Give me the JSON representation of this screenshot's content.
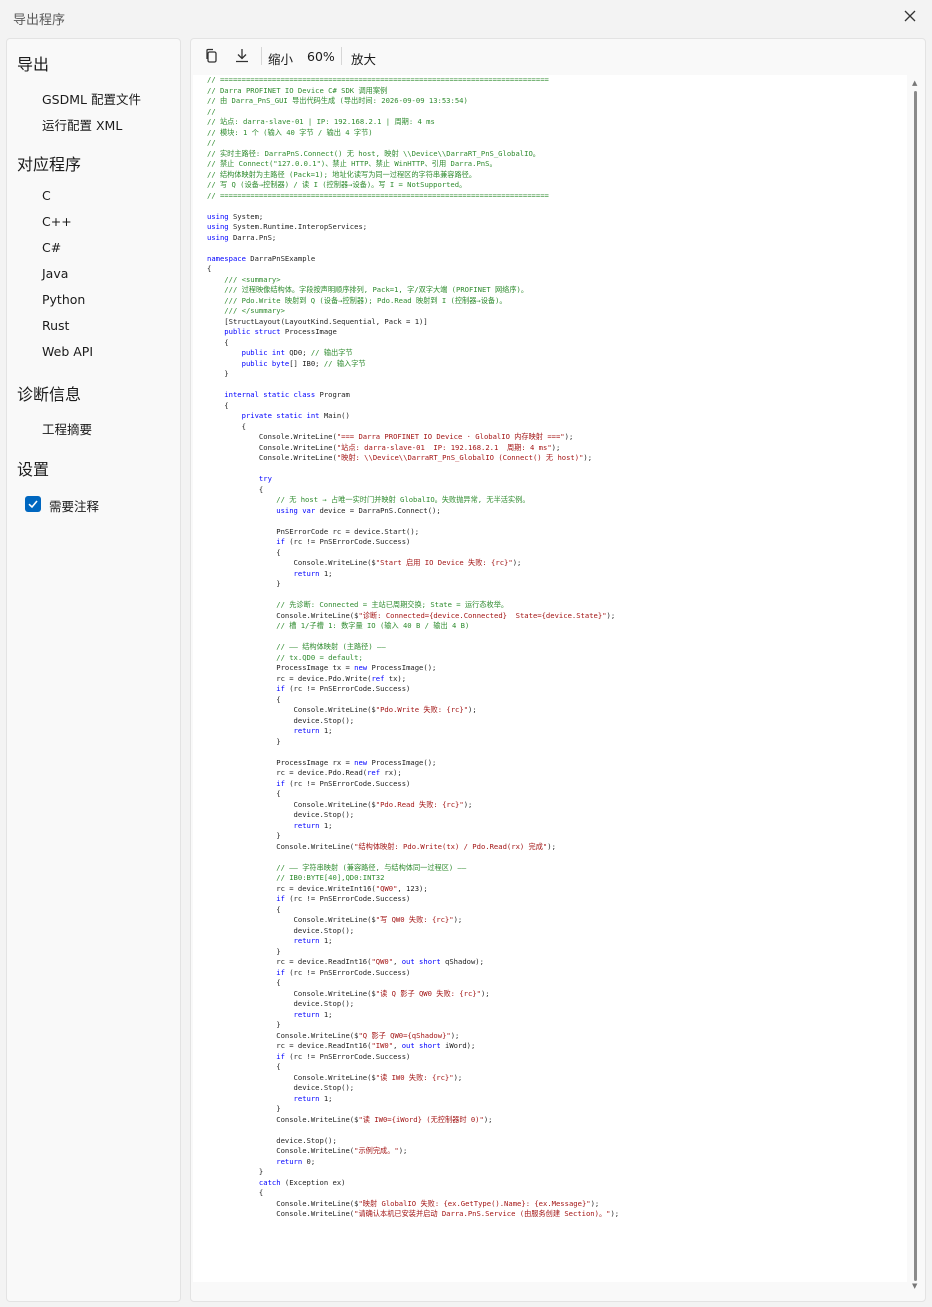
{
  "window": {
    "title": "导出程序"
  },
  "sidebar": {
    "sections": [
      {
        "title": "导出",
        "items": [
          "GSDML 配置文件",
          "运行配置 XML"
        ]
      },
      {
        "title": "对应程序",
        "items": [
          "C",
          "C++",
          "C#",
          "Java",
          "Python",
          "Rust",
          "Web API"
        ]
      },
      {
        "title": "诊断信息",
        "items": [
          "工程摘要"
        ]
      },
      {
        "title": "设置",
        "items": []
      }
    ],
    "checkbox": {
      "label": "需要注释",
      "checked": true
    }
  },
  "toolbar": {
    "zoom_out": "缩小",
    "zoom": "60%",
    "zoom_in": "放大"
  },
  "code": [
    [
      [
        "c",
        "// ============================================================================"
      ]
    ],
    [
      [
        "c",
        "// Darra PROFINET IO Device C# SDK 调用案例"
      ]
    ],
    [
      [
        "c",
        "// 由 Darra_PnS_GUI 导出代码生成 (导出时间: 2026-09-09 13:53:54)"
      ]
    ],
    [
      [
        "c",
        "//"
      ]
    ],
    [
      [
        "c",
        "// 站点: darra-slave-01 | IP: 192.168.2.1 | 周期: 4 ms"
      ]
    ],
    [
      [
        "c",
        "// 模块: 1 个 (输入 40 字节 / 输出 4 字节)"
      ]
    ],
    [
      [
        "c",
        "//"
      ]
    ],
    [
      [
        "c",
        "// 实时主路径: DarraPnS.Connect() 无 host, 映射 \\\\Device\\\\DarraRT_PnS_GlobalIO。"
      ]
    ],
    [
      [
        "c",
        "// 禁止 Connect(\"127.0.0.1\")、禁止 HTTP、禁止 WinHTTP、引用 Darra.PnS。"
      ]
    ],
    [
      [
        "c",
        "// 结构体映射为主路径 (Pack=1); 地址化读写为同一过程区的字符串兼容路径。"
      ]
    ],
    [
      [
        "c",
        "// 写 Q (设备→控制器) / 读 I (控制器→设备)。写 I = NotSupported。"
      ]
    ],
    [
      [
        "c",
        "// ============================================================================"
      ]
    ],
    [],
    [
      [
        "k",
        "using"
      ],
      [
        "p",
        " System;"
      ]
    ],
    [
      [
        "k",
        "using"
      ],
      [
        "p",
        " System.Runtime.InteropServices;"
      ]
    ],
    [
      [
        "k",
        "using"
      ],
      [
        "p",
        " Darra.PnS;"
      ]
    ],
    [],
    [
      [
        "k",
        "namespace"
      ],
      [
        "p",
        " DarraPnSExample"
      ]
    ],
    [
      [
        "p",
        "{"
      ]
    ],
    [
      [
        "c",
        "    /// <summary>"
      ]
    ],
    [
      [
        "c",
        "    /// 过程映像结构体。字段按声明顺序排列, Pack=1, 字/双字大端 (PROFINET 网络序)。"
      ]
    ],
    [
      [
        "c",
        "    /// Pdo.Write 映射到 Q (设备→控制器); Pdo.Read 映射到 I (控制器→设备)。"
      ]
    ],
    [
      [
        "c",
        "    /// </summary>"
      ]
    ],
    [
      [
        "p",
        "    [StructLayout(LayoutKind.Sequential, Pack = 1)]"
      ]
    ],
    [
      [
        "k",
        "    public struct"
      ],
      [
        "p",
        " ProcessImage"
      ]
    ],
    [
      [
        "p",
        "    {"
      ]
    ],
    [
      [
        "k",
        "        public int"
      ],
      [
        "p",
        " QD0; "
      ],
      [
        "c",
        "// 输出字节"
      ]
    ],
    [
      [
        "k",
        "        public byte"
      ],
      [
        "p",
        "[] IB0; "
      ],
      [
        "c",
        "// 输入字节"
      ]
    ],
    [
      [
        "p",
        "    }"
      ]
    ],
    [],
    [
      [
        "k",
        "    internal static class"
      ],
      [
        "p",
        " Program"
      ]
    ],
    [
      [
        "p",
        "    {"
      ]
    ],
    [
      [
        "k",
        "        private static int"
      ],
      [
        "p",
        " Main()"
      ]
    ],
    [
      [
        "p",
        "        {"
      ]
    ],
    [
      [
        "p",
        "            Console.WriteLine("
      ],
      [
        "s",
        "\"=== Darra PROFINET IO Device · GlobalIO 内存映射 ===\""
      ],
      [
        "p",
        ");"
      ]
    ],
    [
      [
        "p",
        "            Console.WriteLine("
      ],
      [
        "s",
        "\"站点: darra-slave-01  IP: 192.168.2.1  周期: 4 ms\""
      ],
      [
        "p",
        ");"
      ]
    ],
    [
      [
        "p",
        "            Console.WriteLine("
      ],
      [
        "s",
        "\"映射: \\\\Device\\\\DarraRT_PnS_GlobalIO (Connect() 无 host)\""
      ],
      [
        "p",
        ");"
      ]
    ],
    [],
    [
      [
        "k",
        "            try"
      ]
    ],
    [
      [
        "p",
        "            {"
      ]
    ],
    [
      [
        "c",
        "                // 无 host → 占唯一实时门并映射 GlobalIO。失败抛异常, 无半活实例。"
      ]
    ],
    [
      [
        "k",
        "                using var"
      ],
      [
        "p",
        " device = DarraPnS.Connect();"
      ]
    ],
    [],
    [
      [
        "p",
        "                PnSErrorCode rc = device.Start();"
      ]
    ],
    [
      [
        "k",
        "                if"
      ],
      [
        "p",
        " (rc != PnSErrorCode.Success)"
      ]
    ],
    [
      [
        "p",
        "                {"
      ]
    ],
    [
      [
        "p",
        "                    Console.WriteLine($"
      ],
      [
        "s",
        "\"Start 启用 IO Device 失败: {rc}\""
      ],
      [
        "p",
        ");"
      ]
    ],
    [
      [
        "k",
        "                    return"
      ],
      [
        "p",
        " 1;"
      ]
    ],
    [
      [
        "p",
        "                }"
      ]
    ],
    [],
    [
      [
        "c",
        "                // 先诊断: Connected = 主站已周期交换; State = 运行态枚举。"
      ]
    ],
    [
      [
        "p",
        "                Console.WriteLine($"
      ],
      [
        "s",
        "\"诊断: Connected={device.Connected}  State={device.State}\""
      ],
      [
        "p",
        ");"
      ]
    ],
    [
      [
        "c",
        "                // 槽 1/子槽 1: 数字量 IO (输入 40 B / 输出 4 B)"
      ]
    ],
    [],
    [
      [
        "c",
        "                // —— 结构体映射 (主路径) ——"
      ]
    ],
    [
      [
        "c",
        "                // tx.QD0 = default;"
      ]
    ],
    [
      [
        "p",
        "                ProcessImage tx = "
      ],
      [
        "k",
        "new"
      ],
      [
        "p",
        " ProcessImage();"
      ]
    ],
    [
      [
        "p",
        "                rc = device.Pdo.Write("
      ],
      [
        "k",
        "ref"
      ],
      [
        "p",
        " tx);"
      ]
    ],
    [
      [
        "k",
        "                if"
      ],
      [
        "p",
        " (rc != PnSErrorCode.Success)"
      ]
    ],
    [
      [
        "p",
        "                {"
      ]
    ],
    [
      [
        "p",
        "                    Console.WriteLine($"
      ],
      [
        "s",
        "\"Pdo.Write 失败: {rc}\""
      ],
      [
        "p",
        ");"
      ]
    ],
    [
      [
        "p",
        "                    device.Stop();"
      ]
    ],
    [
      [
        "k",
        "                    return"
      ],
      [
        "p",
        " 1;"
      ]
    ],
    [
      [
        "p",
        "                }"
      ]
    ],
    [],
    [
      [
        "p",
        "                ProcessImage rx = "
      ],
      [
        "k",
        "new"
      ],
      [
        "p",
        " ProcessImage();"
      ]
    ],
    [
      [
        "p",
        "                rc = device.Pdo.Read("
      ],
      [
        "k",
        "ref"
      ],
      [
        "p",
        " rx);"
      ]
    ],
    [
      [
        "k",
        "                if"
      ],
      [
        "p",
        " (rc != PnSErrorCode.Success)"
      ]
    ],
    [
      [
        "p",
        "                {"
      ]
    ],
    [
      [
        "p",
        "                    Console.WriteLine($"
      ],
      [
        "s",
        "\"Pdo.Read 失败: {rc}\""
      ],
      [
        "p",
        ");"
      ]
    ],
    [
      [
        "p",
        "                    device.Stop();"
      ]
    ],
    [
      [
        "k",
        "                    return"
      ],
      [
        "p",
        " 1;"
      ]
    ],
    [
      [
        "p",
        "                }"
      ]
    ],
    [
      [
        "p",
        "                Console.WriteLine("
      ],
      [
        "s",
        "\"结构体映射: Pdo.Write(tx) / Pdo.Read(rx) 完成\""
      ],
      [
        "p",
        ");"
      ]
    ],
    [],
    [
      [
        "c",
        "                // —— 字符串映射 (兼容路径, 与结构体同一过程区) ——"
      ]
    ],
    [
      [
        "c",
        "                // IB0:BYTE[40],QD0:INT32"
      ]
    ],
    [
      [
        "p",
        "                rc = device.WriteInt16("
      ],
      [
        "s",
        "\"QW0\""
      ],
      [
        "p",
        ", 123);"
      ]
    ],
    [
      [
        "k",
        "                if"
      ],
      [
        "p",
        " (rc != PnSErrorCode.Success)"
      ]
    ],
    [
      [
        "p",
        "                {"
      ]
    ],
    [
      [
        "p",
        "                    Console.WriteLine($"
      ],
      [
        "s",
        "\"写 QW0 失败: {rc}\""
      ],
      [
        "p",
        ");"
      ]
    ],
    [
      [
        "p",
        "                    device.Stop();"
      ]
    ],
    [
      [
        "k",
        "                    return"
      ],
      [
        "p",
        " 1;"
      ]
    ],
    [
      [
        "p",
        "                }"
      ]
    ],
    [
      [
        "p",
        "                rc = device.ReadInt16("
      ],
      [
        "s",
        "\"QW0\""
      ],
      [
        "p",
        ", "
      ],
      [
        "k",
        "out short"
      ],
      [
        "p",
        " qShadow);"
      ]
    ],
    [
      [
        "k",
        "                if"
      ],
      [
        "p",
        " (rc != PnSErrorCode.Success)"
      ]
    ],
    [
      [
        "p",
        "                {"
      ]
    ],
    [
      [
        "p",
        "                    Console.WriteLine($"
      ],
      [
        "s",
        "\"读 Q 影子 QW0 失败: {rc}\""
      ],
      [
        "p",
        ");"
      ]
    ],
    [
      [
        "p",
        "                    device.Stop();"
      ]
    ],
    [
      [
        "k",
        "                    return"
      ],
      [
        "p",
        " 1;"
      ]
    ],
    [
      [
        "p",
        "                }"
      ]
    ],
    [
      [
        "p",
        "                Console.WriteLine($"
      ],
      [
        "s",
        "\"Q 影子 QW0={qShadow}\""
      ],
      [
        "p",
        ");"
      ]
    ],
    [
      [
        "p",
        "                rc = device.ReadInt16("
      ],
      [
        "s",
        "\"IW0\""
      ],
      [
        "p",
        ", "
      ],
      [
        "k",
        "out short"
      ],
      [
        "p",
        " iWord);"
      ]
    ],
    [
      [
        "k",
        "                if"
      ],
      [
        "p",
        " (rc != PnSErrorCode.Success)"
      ]
    ],
    [
      [
        "p",
        "                {"
      ]
    ],
    [
      [
        "p",
        "                    Console.WriteLine($"
      ],
      [
        "s",
        "\"读 IW0 失败: {rc}\""
      ],
      [
        "p",
        ");"
      ]
    ],
    [
      [
        "p",
        "                    device.Stop();"
      ]
    ],
    [
      [
        "k",
        "                    return"
      ],
      [
        "p",
        " 1;"
      ]
    ],
    [
      [
        "p",
        "                }"
      ]
    ],
    [
      [
        "p",
        "                Console.WriteLine($"
      ],
      [
        "s",
        "\"读 IW0={iWord} (无控制器时 0)\""
      ],
      [
        "p",
        ");"
      ]
    ],
    [],
    [
      [
        "p",
        "                device.Stop();"
      ]
    ],
    [
      [
        "p",
        "                Console.WriteLine("
      ],
      [
        "s",
        "\"示例完成。\""
      ],
      [
        "p",
        ");"
      ]
    ],
    [
      [
        "k",
        "                return"
      ],
      [
        "p",
        " 0;"
      ]
    ],
    [
      [
        "p",
        "            }"
      ]
    ],
    [
      [
        "k",
        "            catch"
      ],
      [
        "p",
        " (Exception ex)"
      ]
    ],
    [
      [
        "p",
        "            {"
      ]
    ],
    [
      [
        "p",
        "                Console.WriteLine($"
      ],
      [
        "s",
        "\"映射 GlobalIO 失败: {ex.GetType().Name}: {ex.Message}\""
      ],
      [
        "p",
        ");"
      ]
    ],
    [
      [
        "p",
        "                Console.WriteLine("
      ],
      [
        "s",
        "\"请确认本机已安装并启动 Darra.PnS.Service (由服务创建 Section)。\""
      ],
      [
        "p",
        ");"
      ]
    ]
  ]
}
